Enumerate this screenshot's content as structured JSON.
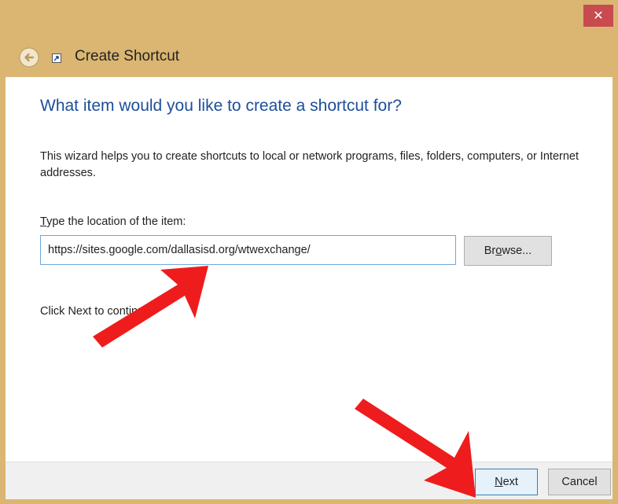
{
  "window": {
    "title": "Create Shortcut",
    "titlebar_color": "#dab672",
    "close_glyph": "✕"
  },
  "wizard": {
    "heading": "What item would you like to create a shortcut for?",
    "description": "This wizard helps you to create shortcuts to local or network programs, files, folders, computers, or Internet addresses.",
    "location_label": {
      "mnemonic": "T",
      "rest": "ype the location of the item:"
    },
    "location_value": "https://sites.google.com/dallasisd.org/wtwexchange/",
    "browse_button": {
      "pre": "Br",
      "mnemonic": "o",
      "post": "wse..."
    },
    "hint": "Click Next to continue."
  },
  "footer": {
    "next_button": {
      "mnemonic": "N",
      "rest": "ext"
    },
    "cancel_button": "Cancel"
  },
  "icons": {
    "back": "back-arrow-icon",
    "app": "shortcut-icon",
    "close": "close-icon"
  },
  "annotations": {
    "arrow_color": "#ee1c1c"
  }
}
